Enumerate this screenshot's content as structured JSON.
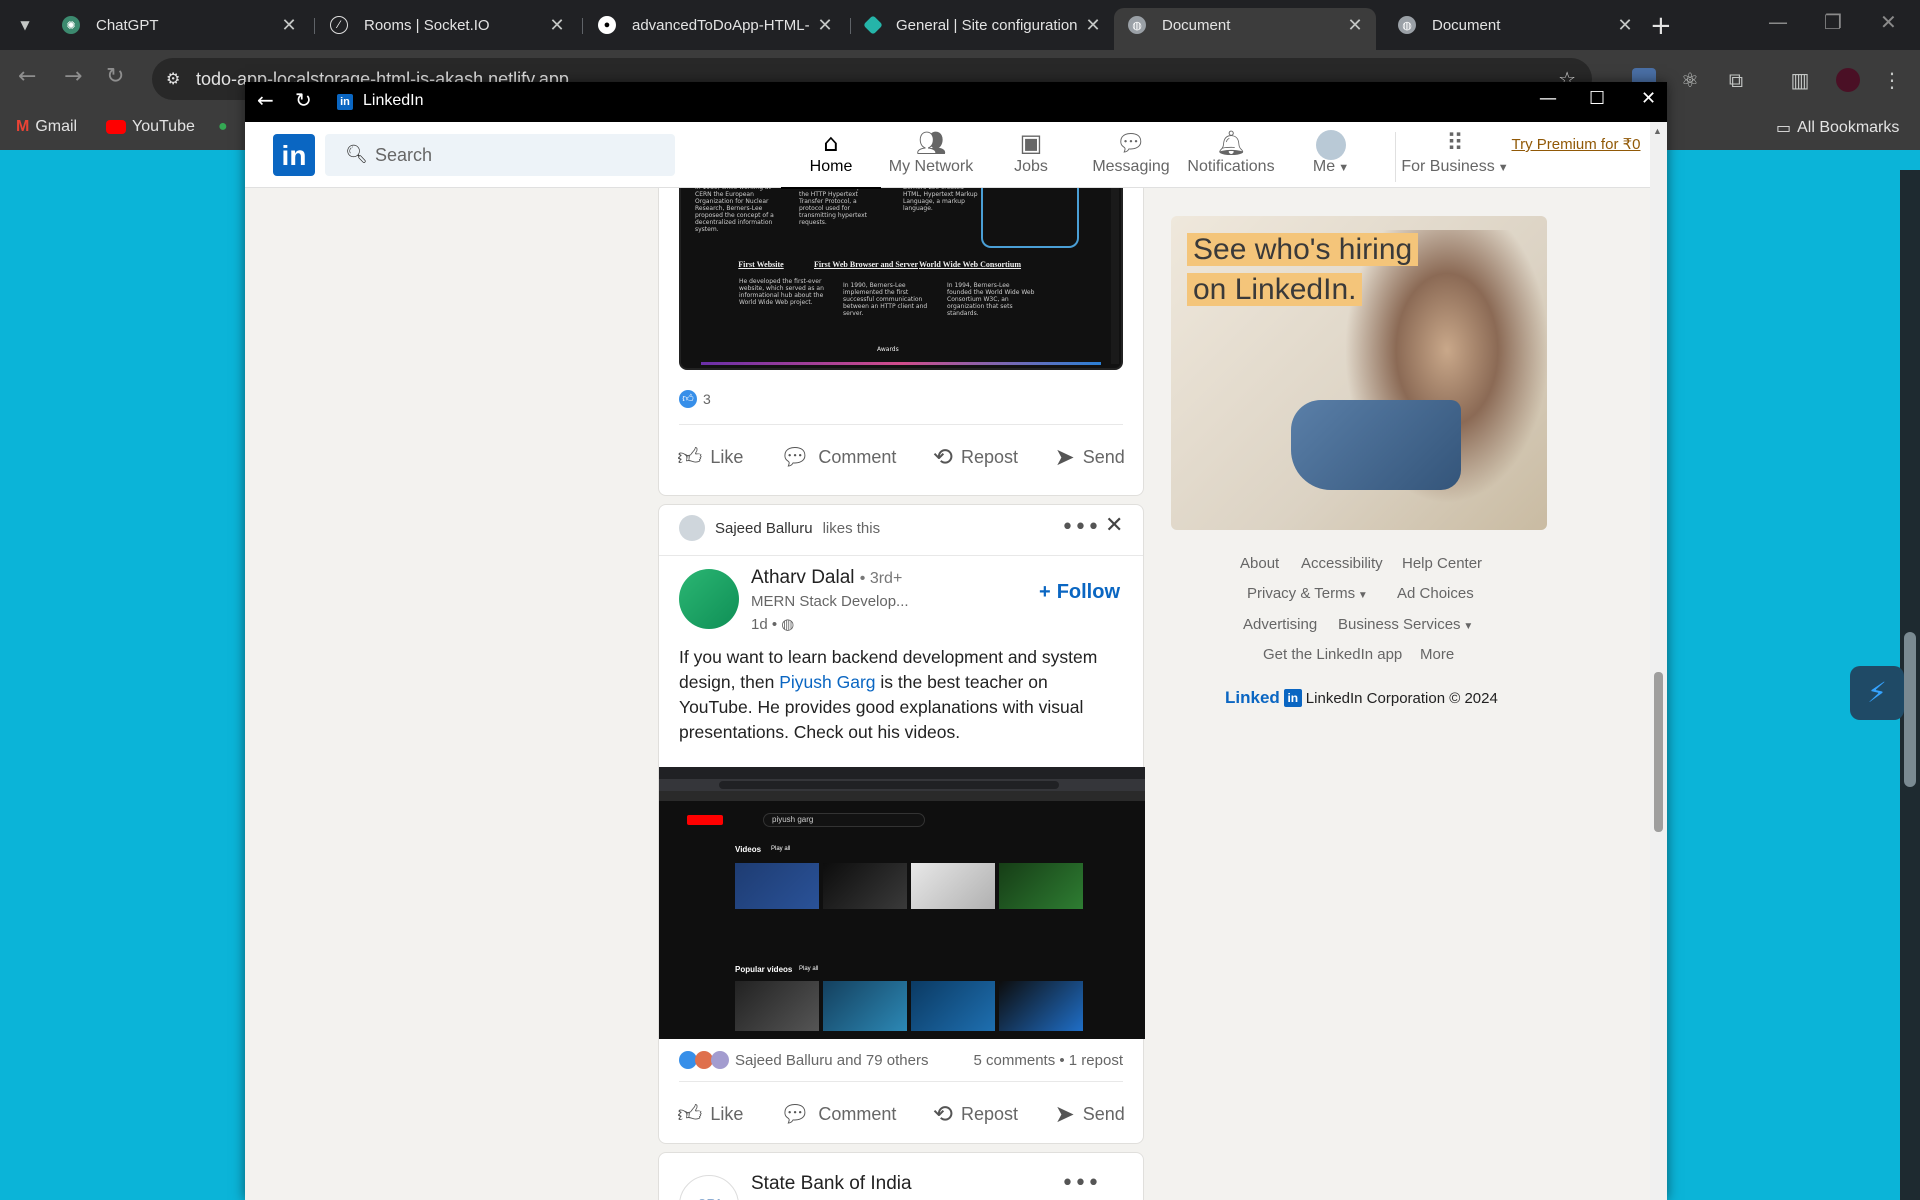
{
  "browser": {
    "tabs": [
      {
        "title": "ChatGPT",
        "icon": "chatgpt-icon",
        "active": false
      },
      {
        "title": "Rooms | Socket.IO",
        "icon": "socketio-icon",
        "active": false
      },
      {
        "title": "advancedToDoApp-HTML-",
        "icon": "github-icon",
        "active": false
      },
      {
        "title": "General | Site configuration",
        "icon": "netlify-icon",
        "active": false
      },
      {
        "title": "Document",
        "icon": "globe-icon",
        "active": true
      },
      {
        "title": "Document",
        "icon": "globe-icon",
        "active": false
      }
    ],
    "url": "todo-app-localstorage-html-js-akash.netlify.app",
    "bookmarks": [
      "Gmail",
      "YouTube"
    ],
    "all_bookmarks": "All Bookmarks"
  },
  "popup": {
    "title": "LinkedIn"
  },
  "header": {
    "search_placeholder": "Search",
    "nav": [
      {
        "label": "Home",
        "icon": "home-icon"
      },
      {
        "label": "My Network",
        "icon": "network-icon"
      },
      {
        "label": "Jobs",
        "icon": "briefcase-icon"
      },
      {
        "label": "Messaging",
        "icon": "chat-icon"
      },
      {
        "label": "Notifications",
        "icon": "bell-icon"
      },
      {
        "label": "Me",
        "icon": "avatar"
      },
      {
        "label": "For Business",
        "icon": "grid-icon"
      }
    ],
    "premium": "Try Premium for ₹0"
  },
  "post1": {
    "image_headings": [
      "First Website",
      "First Web Browser and Server",
      "World Wide Web Consortium"
    ],
    "reactions_count": "3",
    "actions": [
      "Like",
      "Comment",
      "Repost",
      "Send"
    ]
  },
  "post2": {
    "social_context_name": "Sajeed Balluru",
    "social_context_suffix": "likes this",
    "author_name": "Atharv Dalal",
    "author_degree": "• 3rd+",
    "author_headline": "MERN Stack Develop...",
    "author_time": "1d •",
    "follow_label": "Follow",
    "text_before": "If you want to learn backend development and system design, then ",
    "text_link": "Piyush Garg",
    "text_after": " is the best teacher on YouTube. He provides good explanations with visual presentations. Check out his videos.",
    "yt_search": "piyush garg",
    "yt_videos_label": "Videos",
    "yt_popular_label": "Popular videos",
    "yt_play_all": "Play all",
    "reactions_text": "Sajeed Balluru and 79 others",
    "comments_text": "5 comments • 1 repost",
    "actions": [
      "Like",
      "Comment",
      "Repost",
      "Send"
    ]
  },
  "post3": {
    "author_name": "State Bank of India"
  },
  "sidebar": {
    "ad_line1": "See who's hiring",
    "ad_line2": "on LinkedIn.",
    "footer_links": [
      "About",
      "Accessibility",
      "Help Center",
      "Privacy & Terms",
      "Ad Choices",
      "Advertising",
      "Business Services",
      "Get the LinkedIn app",
      "More"
    ],
    "copyright": "LinkedIn Corporation © 2024",
    "brand": "Linked"
  }
}
